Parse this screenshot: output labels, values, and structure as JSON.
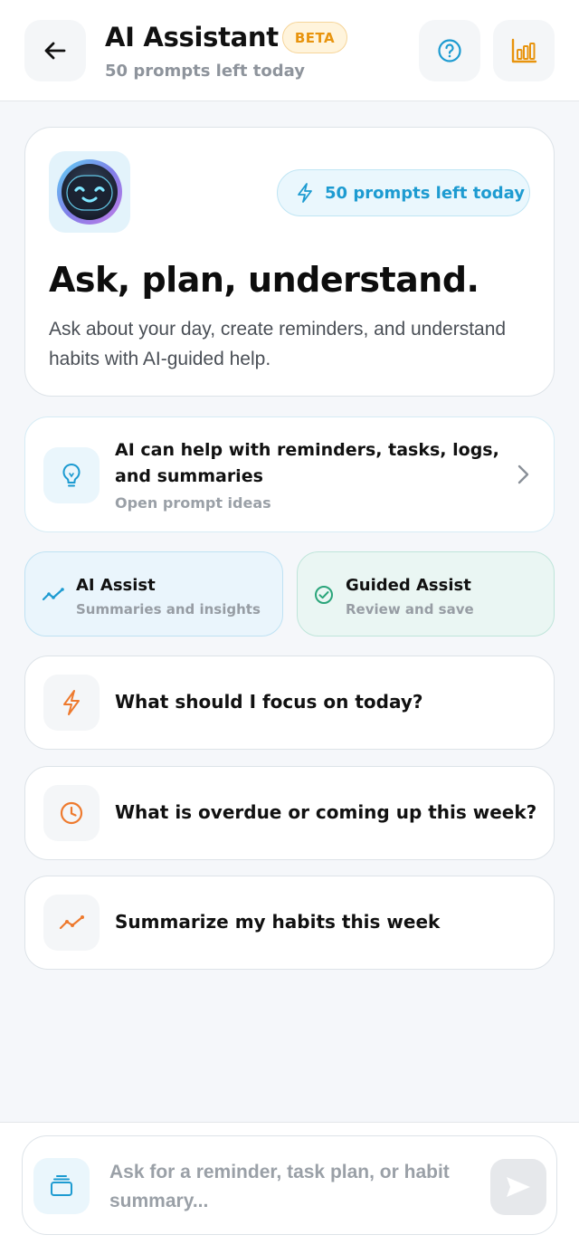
{
  "header": {
    "title": "AI Assistant",
    "badge": "BETA",
    "subtitle": "50 prompts left today",
    "icons": {
      "back": "arrow-left-icon",
      "help": "question-circle-icon",
      "stats": "bar-chart-icon"
    }
  },
  "hero": {
    "pill": "50 prompts left today",
    "title": "Ask, plan, understand.",
    "description": "Ask about your day, create reminders, and understand habits with AI-guided help."
  },
  "tips": {
    "title": "AI can help with reminders, tasks, logs, and summaries",
    "subtitle": "Open prompt ideas"
  },
  "modes": [
    {
      "title": "AI Assist",
      "subtitle": "Summaries and insights"
    },
    {
      "title": "Guided Assist",
      "subtitle": "Review and save"
    }
  ],
  "suggestions": [
    {
      "text": "What should I focus on today?",
      "icon": "lightning-icon"
    },
    {
      "text": "What is overdue or coming up this week?",
      "icon": "clock-icon"
    },
    {
      "text": "Summarize my habits this week",
      "icon": "trend-line-icon"
    }
  ],
  "composer": {
    "placeholder": "Ask for a reminder, task plan, or habit summary..."
  },
  "colors": {
    "accent_blue": "#1d9bd1",
    "accent_orange": "#ee7a2e",
    "beta_orange": "#e8940e",
    "guided_green": "#2aa57a"
  }
}
